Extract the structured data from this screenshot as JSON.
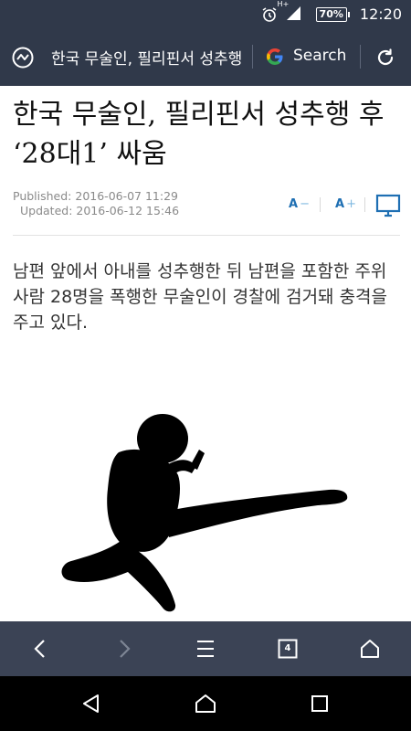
{
  "status_bar": {
    "network": "H+",
    "battery": "70%",
    "time": "12:20"
  },
  "browser": {
    "url_text": "한국 무술인, 필리핀서 성추행 후",
    "search_label": "Search",
    "tab_count": "4"
  },
  "article": {
    "title": "한국 무술인, 필리핀서 성추행 후 ‘28대1’ 싸움",
    "published": "Published: 2016-06-07 11:29",
    "updated": "Updated: 2016-06-12 15:46",
    "font_decrease_label": "A",
    "font_decrease_sym": "−",
    "font_increase_label": "A",
    "font_increase_sym": "+",
    "lead": "남편 앞에서 아내를 성추행한 뒤 남편을 포함한 주위사람 28명을 폭행한 무술인이 경찰에 검거돼 충격을 주고 있다."
  },
  "colors": {
    "topbar": "#30394a",
    "toolbar": "#3b4355",
    "accent": "#1e6fb3",
    "text": "#111111"
  },
  "icons": {
    "url_icon": "trending-circle-icon",
    "google": "google-g-icon",
    "reload": "reload-icon",
    "monitor": "monitor-icon",
    "back": "chevron-left-icon",
    "forward": "chevron-right-icon",
    "menu": "hamburger-menu-icon",
    "tabs": "tab-switcher-icon",
    "home": "home-icon"
  }
}
